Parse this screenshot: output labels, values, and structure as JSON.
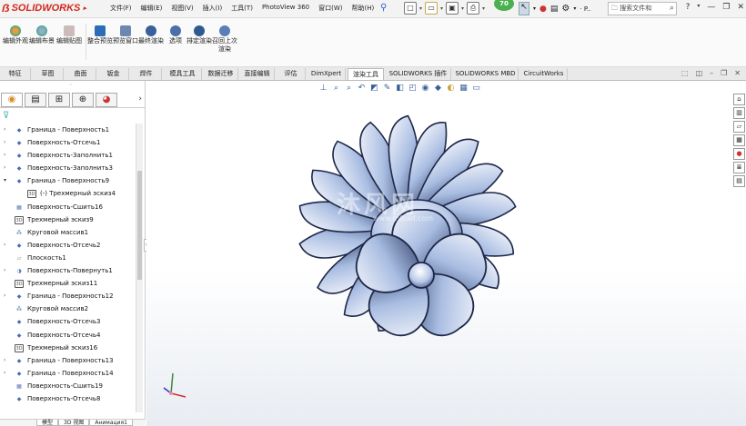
{
  "app": {
    "logo_text": "SOLIDWORKS"
  },
  "menu": [
    "文件(F)",
    "编辑(E)",
    "视图(V)",
    "插入(I)",
    "工具(T)",
    "PhotoView 360",
    "窗口(W)",
    "帮助(H)"
  ],
  "notification_badge": "70",
  "search": {
    "placeholder": "搜索文件和"
  },
  "ribbon_buttons": [
    "编辑外观",
    "编辑布景",
    "编辑贴图",
    "整合预览",
    "预览窗口",
    "最终渲染",
    "选项",
    "排定渲染",
    "召回上次渲染"
  ],
  "tabs": [
    "特征",
    "草图",
    "曲面",
    "钣金",
    "焊件",
    "模具工具",
    "数据迁移",
    "直接编辑",
    "评估",
    "DimXpert",
    "渲染工具",
    "SOLIDWORKS 插件",
    "SOLIDWORKS MBD",
    "CircuitWorks"
  ],
  "active_tab": "渲染工具",
  "tree": [
    {
      "label": "Граница - Поверхность1",
      "icon": "surface-icon",
      "expandable": true,
      "indent": 0
    },
    {
      "label": "Поверхность-Отсечь1",
      "icon": "surface-icon",
      "expandable": true,
      "indent": 0
    },
    {
      "label": "Поверхность-Заполнить1",
      "icon": "surface-icon",
      "expandable": true,
      "indent": 0
    },
    {
      "label": "Поверхность-Заполнить3",
      "icon": "surface-icon",
      "expandable": true,
      "indent": 0
    },
    {
      "label": "Граница - Поверхность9",
      "icon": "surface-icon",
      "expandable": true,
      "expanded": true,
      "indent": 0
    },
    {
      "label": "(-) Трехмерный эскиз4",
      "icon": "sketch3d-icon",
      "expandable": false,
      "indent": 1
    },
    {
      "label": "Поверхность-Сшить16",
      "icon": "knit-icon",
      "expandable": false,
      "indent": 0
    },
    {
      "label": "Трехмерный эскиз9",
      "icon": "sketch3d-icon",
      "expandable": false,
      "indent": 0
    },
    {
      "label": "Круговой массив1",
      "icon": "pattern-icon",
      "expandable": false,
      "indent": 0
    },
    {
      "label": "Поверхность-Отсечь2",
      "icon": "surface-icon",
      "expandable": true,
      "indent": 0
    },
    {
      "label": "Плоскость1",
      "icon": "plane-icon",
      "expandable": false,
      "indent": 0
    },
    {
      "label": "Поверхность-Повернуть1",
      "icon": "revolve-icon",
      "expandable": true,
      "indent": 0
    },
    {
      "label": "Трехмерный эскиз11",
      "icon": "sketch3d-icon",
      "expandable": false,
      "indent": 0
    },
    {
      "label": "Граница - Поверхность12",
      "icon": "surface-icon",
      "expandable": true,
      "indent": 0
    },
    {
      "label": "Круговой массив2",
      "icon": "pattern-icon",
      "expandable": false,
      "indent": 0
    },
    {
      "label": "Поверхность-Отсечь3",
      "icon": "surface-icon",
      "expandable": false,
      "indent": 0
    },
    {
      "label": "Поверхность-Отсечь4",
      "icon": "surface-icon",
      "expandable": false,
      "indent": 0
    },
    {
      "label": "Трехмерный эскиз16",
      "icon": "sketch3d-icon",
      "expandable": false,
      "indent": 0
    },
    {
      "label": "Граница - Поверхность13",
      "icon": "surface-icon",
      "expandable": true,
      "indent": 0
    },
    {
      "label": "Граница - Поверхность14",
      "icon": "surface-icon",
      "expandable": true,
      "indent": 0
    },
    {
      "label": "Поверхность-Сшить19",
      "icon": "knit-icon",
      "expandable": false,
      "indent": 0
    },
    {
      "label": "Поверхность-Отсечь8",
      "icon": "surface-icon",
      "expandable": false,
      "indent": 0
    }
  ],
  "bottom_tabs": [
    "模型",
    "3D 视图",
    "Анимация1"
  ],
  "watermark": "沐风网",
  "watermark_url": "www.mfcad.com",
  "colors": {
    "accent": "#2563c9",
    "logo_red": "#d12b1f",
    "model_blue": "#8ea6d6"
  }
}
